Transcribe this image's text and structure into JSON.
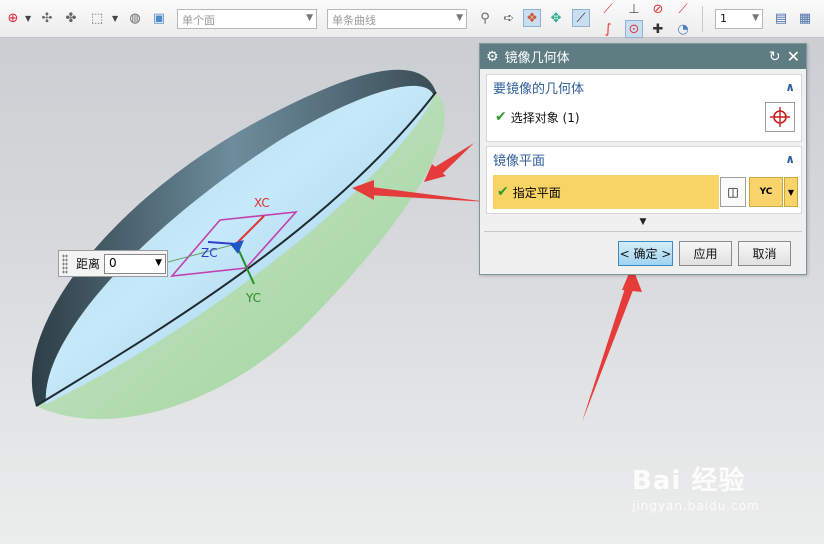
{
  "toolbar": {
    "filter_select": "单个面",
    "curve_select": "单条曲线",
    "scale_select": "1"
  },
  "distance": {
    "label": "距离",
    "value": "0"
  },
  "dialog": {
    "title": "镜像几何体",
    "group1": {
      "title": "要镜像的几何体",
      "row_label": "选择对象 (1)"
    },
    "group2": {
      "title": "镜像平面",
      "row_label": "指定平面",
      "plane_option": "YC"
    },
    "buttons": {
      "ok": "< 确定 >",
      "apply": "应用",
      "cancel": "取消"
    }
  },
  "axes": {
    "x": "XC",
    "y": "YC",
    "z": "ZC"
  },
  "watermark": {
    "brand": "Bai 经验",
    "url": "jingyan.baidu.com"
  },
  "colors": {
    "title_bar": "#5d7d83",
    "highlight": "#f8d464",
    "arrow": "#e53b3b",
    "ok_button": "#9fd3f1"
  }
}
